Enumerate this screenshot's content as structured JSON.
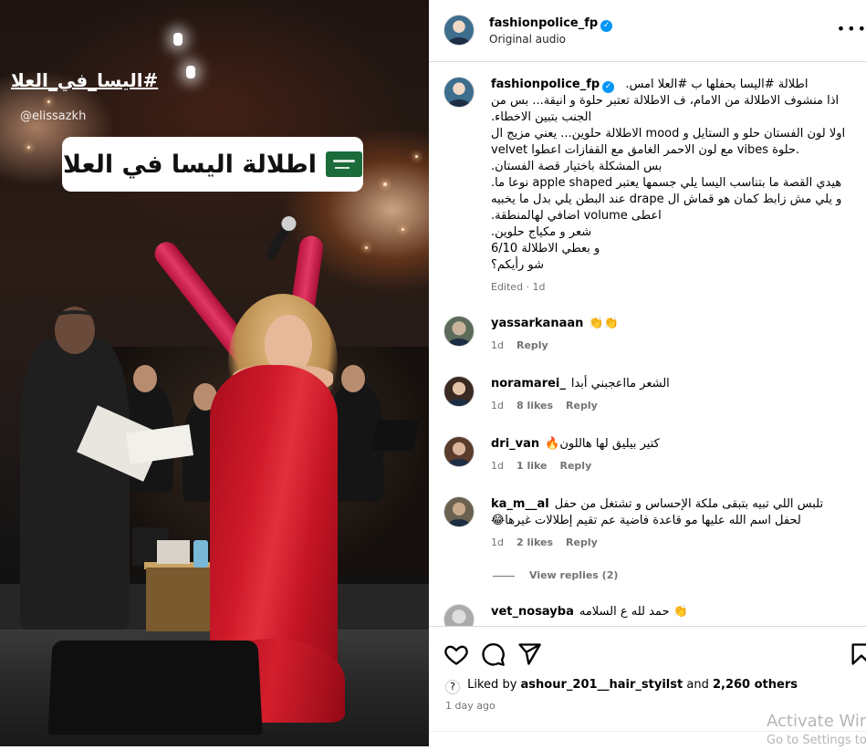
{
  "video": {
    "hashtag_overlay": "#اليسا_في_العلا",
    "mention_overlay": "@elissazkh",
    "caption_overlay": "اطلالة اليسا في العلا",
    "flag_icon": "saudi-flag-icon"
  },
  "header": {
    "username": "fashionpolice_fp",
    "subtitle": "Original audio",
    "more_icon": "ellipsis-icon"
  },
  "post": {
    "username": "fashionpolice_fp",
    "lines": [
      "اطلالة #اليسا بحفلها ب #العلا امس.",
      "اذا منشوف الاطلالة من الامام، ف الاطلالة تعتبر حلوة و انيقة... بس من",
      "الجنب بتبين الاخطاء.",
      "اولا لون الفستان حلو و الستايل و mood الاطلالة حلوين... يعني مزيج ال",
      "velvet مع لون الاحمر الغامق مع القفازات اعطوا vibes حلوة.",
      "بس المشكلة باختيار قصة الفستان.",
      "هيدي القصة ما بتناسب اليسا يلي جسمها يعتبر apple shaped نوعا ما.",
      "و يلي مش زابط كمان هو قماش ال drape عند البطن يلي بدل ما يخبيه",
      "اعطى volume اضافي لهالمنطقة.",
      "شعر و مكياج حلوين.",
      "و بعطي الاطلالة 6/10",
      "شو رأيكم؟"
    ],
    "meta": "Edited · 1d"
  },
  "comments": [
    {
      "user": "yassarkanaan",
      "text": "👏👏",
      "time": "1d",
      "likes": "",
      "reply": "Reply"
    },
    {
      "user": "noramarei_",
      "text": "الشعر مااعجبني أبدا",
      "time": "1d",
      "likes": "8 likes",
      "reply": "Reply"
    },
    {
      "user": "dri_van",
      "text": "كتير بيليق لها هاللون🔥",
      "time": "1d",
      "likes": "1 like",
      "reply": "Reply"
    },
    {
      "user": "ka_m__al",
      "text": "تلبس اللي تبيه بتبقى ملكة الإحساس و تشتغل من حفل",
      "text2": "لحفل اسم الله عليها مو قاعدة فاضية عم تقيم إطلالات غيرها😂",
      "time": "1d",
      "likes": "2 likes",
      "reply": "Reply"
    },
    {
      "user": "vet_nosayba",
      "text": "👏 حمد لله ع السلامه"
    }
  ],
  "view_replies": "View replies (2)",
  "actions": {
    "likes_prefix": "Liked by",
    "likes_user": "ashour_201__hair_styilst",
    "likes_and": "and",
    "likes_others": "2,260 others",
    "time_ago": "1 day ago"
  },
  "watermark": {
    "line1": "Activate Win",
    "line2": "Go to Settings to"
  }
}
